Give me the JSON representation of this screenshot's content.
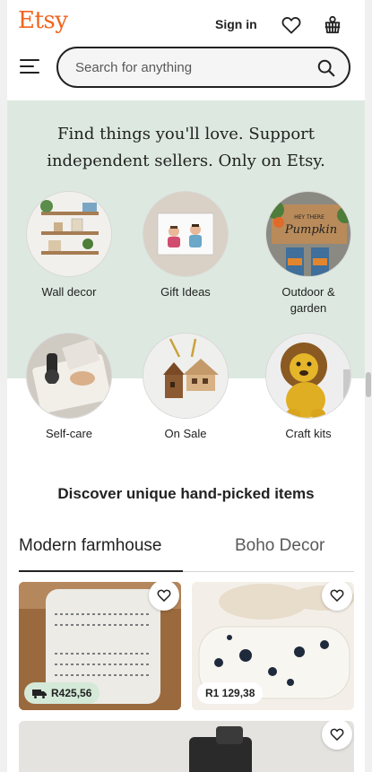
{
  "header": {
    "logo": "Etsy",
    "sign_in": "Sign in",
    "search_placeholder": "Search for anything"
  },
  "hero": {
    "tagline_line1": "Find things you'll love. Support",
    "tagline_line2": "independent sellers. Only on Etsy."
  },
  "categories": [
    {
      "label": "Wall decor"
    },
    {
      "label": "Gift Ideas"
    },
    {
      "label_line1": "Outdoor &",
      "label_line2": "garden"
    },
    {
      "label": "Self-care"
    },
    {
      "label": "On Sale"
    },
    {
      "label": "Craft kits"
    }
  ],
  "discover": {
    "title": "Discover unique hand-picked items",
    "tabs": [
      {
        "label": "Modern farmhouse",
        "active": true
      },
      {
        "label": "Boho Decor",
        "active": false
      }
    ]
  },
  "listings": [
    {
      "price": "R425,56",
      "free_shipping": true,
      "badge_color": "#d4e9d7"
    },
    {
      "price": "R1 129,38",
      "free_shipping": false,
      "badge_color": "#ffffff"
    },
    {
      "price": "",
      "free_shipping": false
    }
  ],
  "colors": {
    "brand": "#f1641e",
    "hero_bg": "#dde9e0",
    "text": "#222222"
  },
  "icons": [
    "heart-icon",
    "shopping-basket-icon",
    "hamburger-menu-icon",
    "search-icon",
    "truck-icon"
  ]
}
